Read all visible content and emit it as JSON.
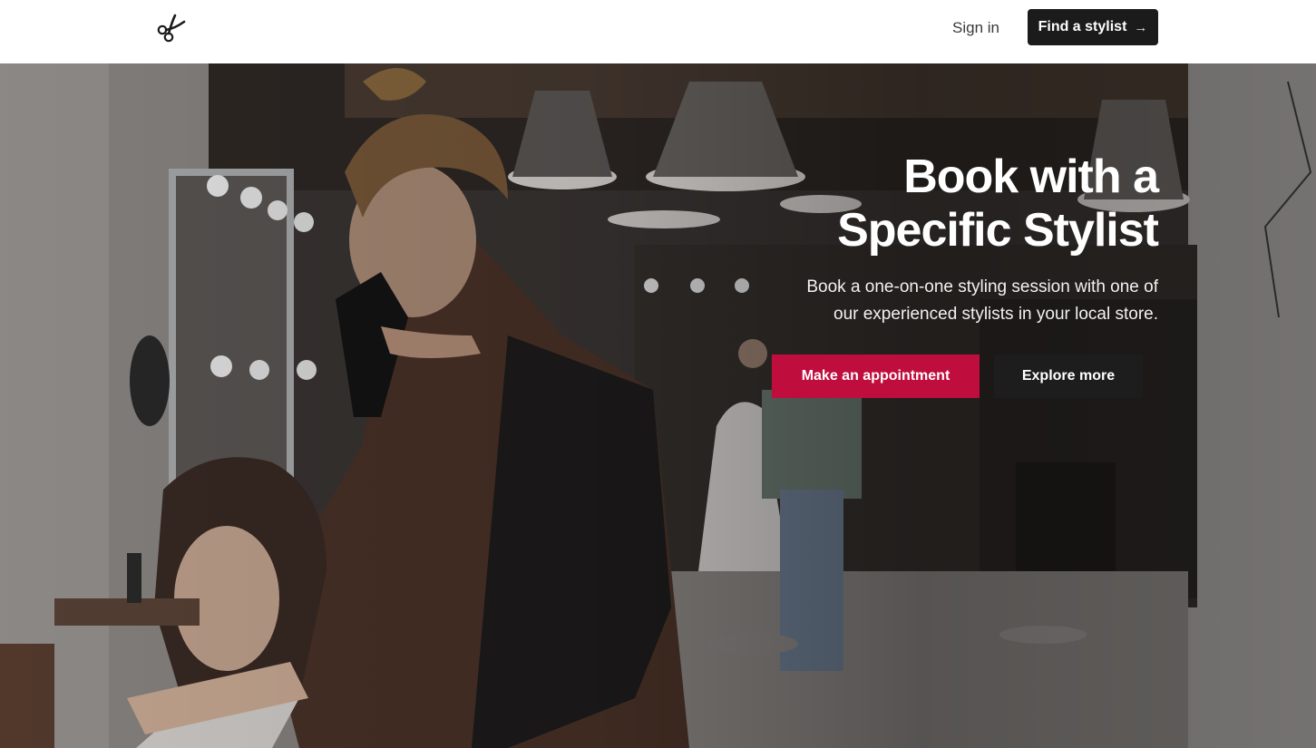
{
  "header": {
    "logo_icon": "scissors-icon",
    "signin_label": "Sign in",
    "find_label": "Find a stylist",
    "find_icon": "arrow-right-icon"
  },
  "hero": {
    "title_line1": "Book with a",
    "title_line2": "Specific Stylist",
    "subtitle_line1": "Book a one-on-one styling session with one of",
    "subtitle_line2": "our experienced stylists in your local store.",
    "primary_cta": "Make an appointment",
    "secondary_cta": "Explore more"
  },
  "colors": {
    "accent": "#bf0d3e",
    "dark_button": "#1b1b1b",
    "header_bg": "#ffffff"
  }
}
